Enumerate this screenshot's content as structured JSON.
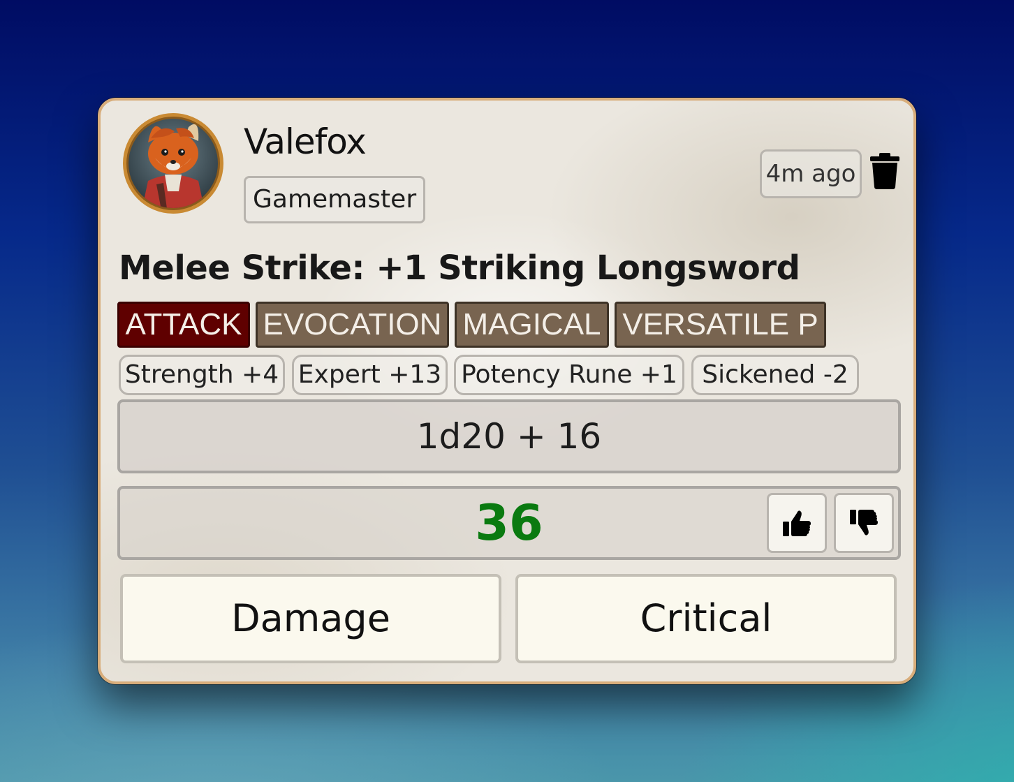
{
  "message": {
    "author": "Valefox",
    "role": "Gamemaster",
    "timestamp": "4m ago",
    "title": "Melee Strike: +1 Striking Longsword"
  },
  "traits": [
    "ATTACK",
    "EVOCATION",
    "MAGICAL",
    "VERSATILE P"
  ],
  "modifiers": [
    "Strength +4",
    "Expert +13",
    "Potency Rune +1",
    "Sickened -2"
  ],
  "roll": {
    "formula": "1d20 + 16",
    "total": "36",
    "total_color": "#0a7a10"
  },
  "actions": {
    "damage": "Damage",
    "critical": "Critical"
  },
  "icons": {
    "delete": "trash-icon",
    "upvote": "thumbs-up-icon",
    "downvote": "thumbs-down-icon"
  },
  "colors": {
    "attack_tag": "#5f0000",
    "trait_tag": "#786450",
    "card_border": "#d8ad7b"
  }
}
